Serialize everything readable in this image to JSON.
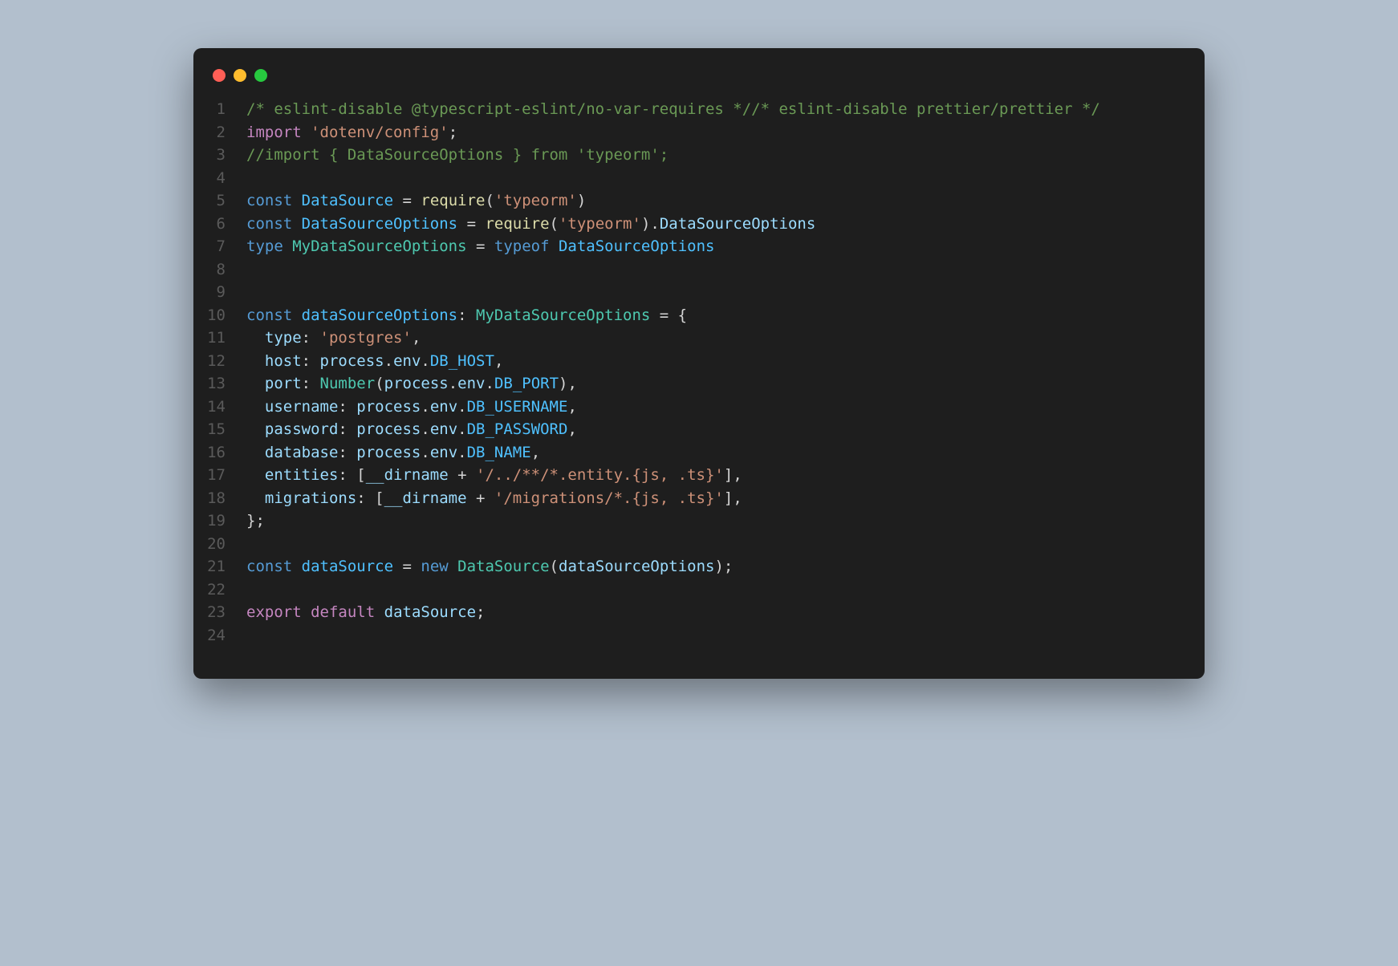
{
  "window": {
    "traffic_lights": [
      "red",
      "yellow",
      "green"
    ]
  },
  "code": {
    "lines": [
      {
        "n": 1,
        "tokens": [
          {
            "c": "c-comment",
            "t": "/* eslint-disable @typescript-eslint/no-var-requires */"
          },
          {
            "c": "c-comment",
            "t": "/* eslint-disable prettier/prettier */"
          }
        ]
      },
      {
        "n": 2,
        "tokens": [
          {
            "c": "c-keyword",
            "t": "import"
          },
          {
            "c": "c-punct",
            "t": " "
          },
          {
            "c": "c-string",
            "t": "'dotenv/config'"
          },
          {
            "c": "c-punct",
            "t": ";"
          }
        ]
      },
      {
        "n": 3,
        "tokens": [
          {
            "c": "c-comment",
            "t": "//import { DataSourceOptions } from 'typeorm';"
          }
        ]
      },
      {
        "n": 4,
        "tokens": []
      },
      {
        "n": 5,
        "tokens": [
          {
            "c": "c-blue",
            "t": "const"
          },
          {
            "c": "c-punct",
            "t": " "
          },
          {
            "c": "c-const",
            "t": "DataSource"
          },
          {
            "c": "c-punct",
            "t": " = "
          },
          {
            "c": "c-func",
            "t": "require"
          },
          {
            "c": "c-punct",
            "t": "("
          },
          {
            "c": "c-string",
            "t": "'typeorm'"
          },
          {
            "c": "c-punct",
            "t": ")"
          }
        ]
      },
      {
        "n": 6,
        "tokens": [
          {
            "c": "c-blue",
            "t": "const"
          },
          {
            "c": "c-punct",
            "t": " "
          },
          {
            "c": "c-const",
            "t": "DataSourceOptions"
          },
          {
            "c": "c-punct",
            "t": " = "
          },
          {
            "c": "c-func",
            "t": "require"
          },
          {
            "c": "c-punct",
            "t": "("
          },
          {
            "c": "c-string",
            "t": "'typeorm'"
          },
          {
            "c": "c-punct",
            "t": ")."
          },
          {
            "c": "c-var",
            "t": "DataSourceOptions"
          }
        ]
      },
      {
        "n": 7,
        "tokens": [
          {
            "c": "c-blue",
            "t": "type"
          },
          {
            "c": "c-punct",
            "t": " "
          },
          {
            "c": "c-type",
            "t": "MyDataSourceOptions"
          },
          {
            "c": "c-punct",
            "t": " = "
          },
          {
            "c": "c-blue",
            "t": "typeof"
          },
          {
            "c": "c-punct",
            "t": " "
          },
          {
            "c": "c-const",
            "t": "DataSourceOptions"
          }
        ]
      },
      {
        "n": 8,
        "tokens": []
      },
      {
        "n": 9,
        "tokens": []
      },
      {
        "n": 10,
        "tokens": [
          {
            "c": "c-blue",
            "t": "const"
          },
          {
            "c": "c-punct",
            "t": " "
          },
          {
            "c": "c-const",
            "t": "dataSourceOptions"
          },
          {
            "c": "c-punct",
            "t": ": "
          },
          {
            "c": "c-type",
            "t": "MyDataSourceOptions"
          },
          {
            "c": "c-punct",
            "t": " = {"
          }
        ]
      },
      {
        "n": 11,
        "tokens": [
          {
            "c": "c-punct",
            "t": "  "
          },
          {
            "c": "c-var",
            "t": "type"
          },
          {
            "c": "c-punct",
            "t": ": "
          },
          {
            "c": "c-string",
            "t": "'postgres'"
          },
          {
            "c": "c-punct",
            "t": ","
          }
        ]
      },
      {
        "n": 12,
        "tokens": [
          {
            "c": "c-punct",
            "t": "  "
          },
          {
            "c": "c-var",
            "t": "host"
          },
          {
            "c": "c-punct",
            "t": ": "
          },
          {
            "c": "c-var",
            "t": "process"
          },
          {
            "c": "c-punct",
            "t": "."
          },
          {
            "c": "c-var",
            "t": "env"
          },
          {
            "c": "c-punct",
            "t": "."
          },
          {
            "c": "c-const",
            "t": "DB_HOST"
          },
          {
            "c": "c-punct",
            "t": ","
          }
        ]
      },
      {
        "n": 13,
        "tokens": [
          {
            "c": "c-punct",
            "t": "  "
          },
          {
            "c": "c-var",
            "t": "port"
          },
          {
            "c": "c-punct",
            "t": ": "
          },
          {
            "c": "c-type",
            "t": "Number"
          },
          {
            "c": "c-punct",
            "t": "("
          },
          {
            "c": "c-var",
            "t": "process"
          },
          {
            "c": "c-punct",
            "t": "."
          },
          {
            "c": "c-var",
            "t": "env"
          },
          {
            "c": "c-punct",
            "t": "."
          },
          {
            "c": "c-const",
            "t": "DB_PORT"
          },
          {
            "c": "c-punct",
            "t": "),"
          }
        ]
      },
      {
        "n": 14,
        "tokens": [
          {
            "c": "c-punct",
            "t": "  "
          },
          {
            "c": "c-var",
            "t": "username"
          },
          {
            "c": "c-punct",
            "t": ": "
          },
          {
            "c": "c-var",
            "t": "process"
          },
          {
            "c": "c-punct",
            "t": "."
          },
          {
            "c": "c-var",
            "t": "env"
          },
          {
            "c": "c-punct",
            "t": "."
          },
          {
            "c": "c-const",
            "t": "DB_USERNAME"
          },
          {
            "c": "c-punct",
            "t": ","
          }
        ]
      },
      {
        "n": 15,
        "tokens": [
          {
            "c": "c-punct",
            "t": "  "
          },
          {
            "c": "c-var",
            "t": "password"
          },
          {
            "c": "c-punct",
            "t": ": "
          },
          {
            "c": "c-var",
            "t": "process"
          },
          {
            "c": "c-punct",
            "t": "."
          },
          {
            "c": "c-var",
            "t": "env"
          },
          {
            "c": "c-punct",
            "t": "."
          },
          {
            "c": "c-const",
            "t": "DB_PASSWORD"
          },
          {
            "c": "c-punct",
            "t": ","
          }
        ]
      },
      {
        "n": 16,
        "tokens": [
          {
            "c": "c-punct",
            "t": "  "
          },
          {
            "c": "c-var",
            "t": "database"
          },
          {
            "c": "c-punct",
            "t": ": "
          },
          {
            "c": "c-var",
            "t": "process"
          },
          {
            "c": "c-punct",
            "t": "."
          },
          {
            "c": "c-var",
            "t": "env"
          },
          {
            "c": "c-punct",
            "t": "."
          },
          {
            "c": "c-const",
            "t": "DB_NAME"
          },
          {
            "c": "c-punct",
            "t": ","
          }
        ]
      },
      {
        "n": 17,
        "tokens": [
          {
            "c": "c-punct",
            "t": "  "
          },
          {
            "c": "c-var",
            "t": "entities"
          },
          {
            "c": "c-punct",
            "t": ": ["
          },
          {
            "c": "c-var",
            "t": "__dirname"
          },
          {
            "c": "c-punct",
            "t": " + "
          },
          {
            "c": "c-string",
            "t": "'/../**/*.entity.{js, .ts}'"
          },
          {
            "c": "c-punct",
            "t": "],"
          }
        ]
      },
      {
        "n": 18,
        "tokens": [
          {
            "c": "c-punct",
            "t": "  "
          },
          {
            "c": "c-var",
            "t": "migrations"
          },
          {
            "c": "c-punct",
            "t": ": ["
          },
          {
            "c": "c-var",
            "t": "__dirname"
          },
          {
            "c": "c-punct",
            "t": " + "
          },
          {
            "c": "c-string",
            "t": "'/migrations/*.{js, .ts}'"
          },
          {
            "c": "c-punct",
            "t": "],"
          }
        ]
      },
      {
        "n": 19,
        "tokens": [
          {
            "c": "c-punct",
            "t": "};"
          }
        ]
      },
      {
        "n": 20,
        "tokens": []
      },
      {
        "n": 21,
        "tokens": [
          {
            "c": "c-blue",
            "t": "const"
          },
          {
            "c": "c-punct",
            "t": " "
          },
          {
            "c": "c-const",
            "t": "dataSource"
          },
          {
            "c": "c-punct",
            "t": " = "
          },
          {
            "c": "c-blue",
            "t": "new"
          },
          {
            "c": "c-punct",
            "t": " "
          },
          {
            "c": "c-type",
            "t": "DataSource"
          },
          {
            "c": "c-punct",
            "t": "("
          },
          {
            "c": "c-var",
            "t": "dataSourceOptions"
          },
          {
            "c": "c-punct",
            "t": ");"
          }
        ]
      },
      {
        "n": 22,
        "tokens": []
      },
      {
        "n": 23,
        "tokens": [
          {
            "c": "c-keyword",
            "t": "export"
          },
          {
            "c": "c-punct",
            "t": " "
          },
          {
            "c": "c-keyword",
            "t": "default"
          },
          {
            "c": "c-punct",
            "t": " "
          },
          {
            "c": "c-var",
            "t": "dataSource"
          },
          {
            "c": "c-punct",
            "t": ";"
          }
        ]
      },
      {
        "n": 24,
        "tokens": []
      }
    ]
  }
}
